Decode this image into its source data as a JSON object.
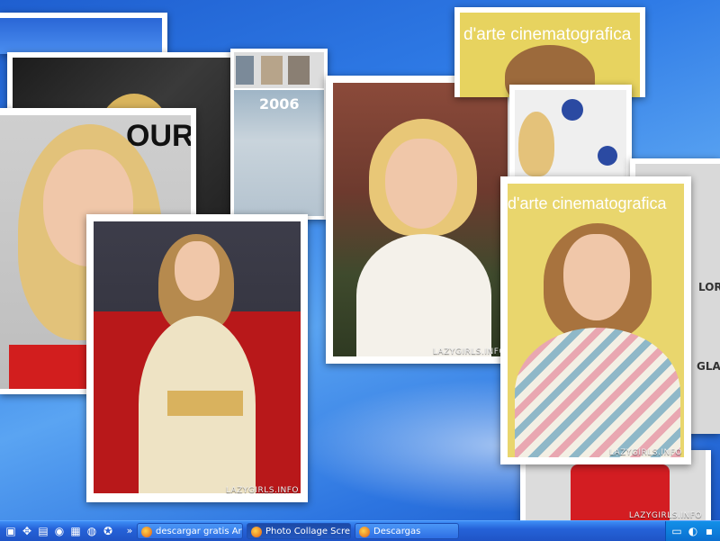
{
  "watermark": "LAZYGIRLS.INFO",
  "photo_texts": {
    "year_label": "2006",
    "magazine_partial": "OUR",
    "banner_top": "d'arte cinematografica",
    "banner_mid": "d'arte cinematografica",
    "partial_text_1": "GLAM",
    "partial_text_2": "LOR"
  },
  "taskbar": {
    "quicklaunch_more": "»",
    "buttons": [
      {
        "label": "descargar gratis Ares..."
      },
      {
        "label": "Photo Collage Screen..."
      },
      {
        "label": "Descargas"
      }
    ]
  },
  "colors": {
    "taskbar": "#2562d8",
    "desktop": "#2f7be6"
  }
}
